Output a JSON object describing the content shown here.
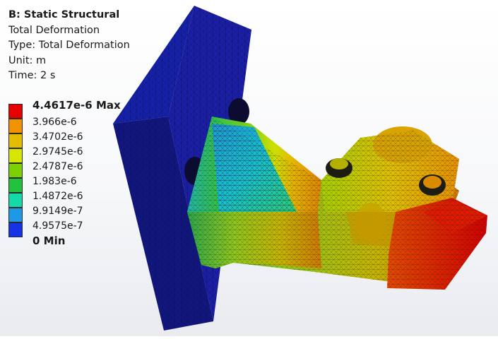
{
  "result": {
    "title": "B: Static Structural",
    "name": "Total Deformation",
    "type": "Type: Total Deformation",
    "unit": "Unit: m",
    "time": "Time: 2 s"
  },
  "legend": {
    "max_label": "4.4617e-6 Max",
    "min_label": "0 Min",
    "levels": [
      "3.966e-6",
      "3.4702e-6",
      "2.9745e-6",
      "2.4787e-6",
      "1.983e-6",
      "1.4872e-6",
      "9.9149e-7",
      "4.9575e-7"
    ],
    "band_colors": [
      "#e60000",
      "#f39200",
      "#e3bd00",
      "#d5e600",
      "#7ad000",
      "#22c23c",
      "#14d9a9",
      "#1f98e6",
      "#1432e6"
    ]
  },
  "model": {
    "plate_color": "#1a1fa6",
    "mesh_color": "#10124a"
  }
}
